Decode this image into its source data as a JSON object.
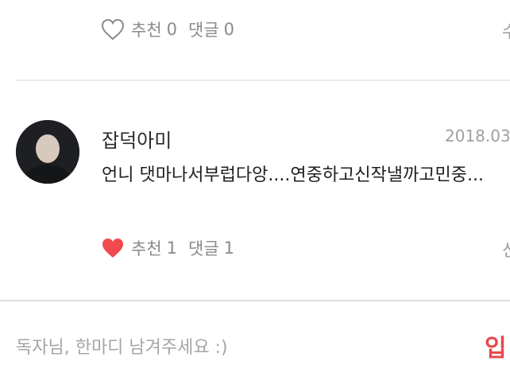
{
  "comment_top": {
    "like_label": "추천",
    "like_count": "0",
    "reply_label": "댓글",
    "reply_count": "0",
    "cut_text": "수"
  },
  "comment": {
    "author": "잡덕아미",
    "date": "2018.03",
    "body": "언니 댓마나서부럽다앙....연중하고신작낼까고민중...",
    "like_label": "추천",
    "like_count": "1",
    "reply_label": "댓글",
    "reply_count": "1",
    "liked": true,
    "cut_text": "신"
  },
  "input": {
    "placeholder": "독자님, 한마디 남겨주세요 :)",
    "submit_label": "입"
  },
  "colors": {
    "heart_active": "#f04a4f",
    "heart_inactive": "#8a8a8a",
    "submit": "#e8484b"
  },
  "icons": [
    "heart-outline-icon",
    "heart-filled-icon",
    "avatar"
  ]
}
